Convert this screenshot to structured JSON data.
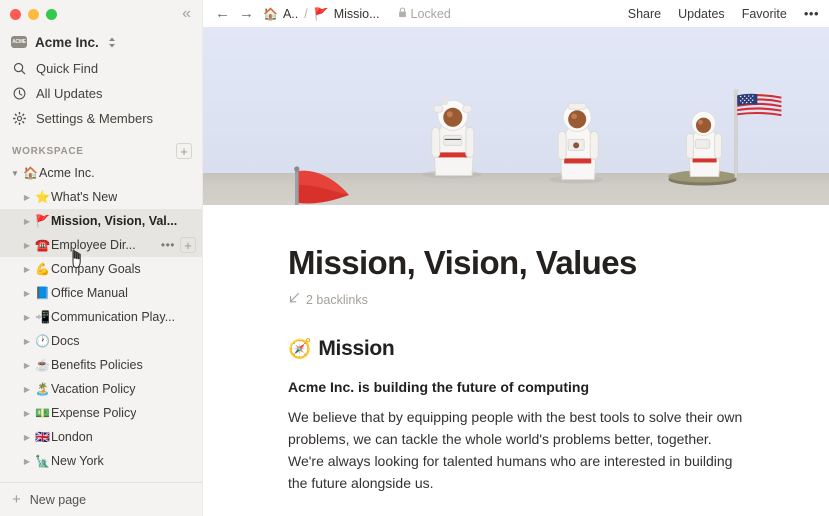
{
  "window": {
    "traffic_lights": [
      "close",
      "minimize",
      "zoom"
    ],
    "collapse_icon": "«"
  },
  "sidebar": {
    "workspace_switcher": {
      "name": "Acme Inc.",
      "logo_text": "ACME",
      "chevron": "⌃⌄"
    },
    "nav": [
      {
        "icon": "search-icon",
        "label": "Quick Find"
      },
      {
        "icon": "clock-icon",
        "label": "All Updates"
      },
      {
        "icon": "gear-icon",
        "label": "Settings & Members"
      }
    ],
    "section": {
      "title": "WORKSPACE",
      "add_label": "+"
    },
    "tree": [
      {
        "emoji": "🏠",
        "label": "Acme Inc.",
        "depth": 0,
        "expanded": true,
        "state": "normal"
      },
      {
        "emoji": "⭐",
        "label": "What's New",
        "depth": 1,
        "expanded": false,
        "state": "normal"
      },
      {
        "emoji": "🚩",
        "label": "Mission, Vision, Val...",
        "depth": 1,
        "expanded": false,
        "state": "selected"
      },
      {
        "emoji": "☎️",
        "label": "Employee Dir...",
        "depth": 1,
        "expanded": false,
        "state": "hovered"
      },
      {
        "emoji": "💪",
        "label": "Company Goals",
        "depth": 1,
        "expanded": false,
        "state": "normal"
      },
      {
        "emoji": "📘",
        "label": "Office Manual",
        "depth": 1,
        "expanded": false,
        "state": "normal"
      },
      {
        "emoji": "📲",
        "label": "Communication Play...",
        "depth": 1,
        "expanded": false,
        "state": "normal"
      },
      {
        "emoji": "🕐",
        "label": "Docs",
        "depth": 1,
        "expanded": false,
        "state": "normal"
      },
      {
        "emoji": "☕",
        "label": "Benefits Policies",
        "depth": 1,
        "expanded": false,
        "state": "normal"
      },
      {
        "emoji": "🏝️",
        "label": "Vacation Policy",
        "depth": 1,
        "expanded": false,
        "state": "normal"
      },
      {
        "emoji": "💵",
        "label": "Expense Policy",
        "depth": 1,
        "expanded": false,
        "state": "normal"
      },
      {
        "emoji": "🇬🇧",
        "label": "London",
        "depth": 1,
        "expanded": false,
        "state": "normal"
      },
      {
        "emoji": "🗽",
        "label": "New York",
        "depth": 1,
        "expanded": false,
        "state": "normal"
      }
    ],
    "row_actions": {
      "more": "•••",
      "add": "+"
    },
    "footer": {
      "plus": "+",
      "label": "New page"
    }
  },
  "topbar": {
    "back_icon": "←",
    "forward_icon": "→",
    "breadcrumb": [
      {
        "emoji": "🏠",
        "label": "A.."
      },
      {
        "emoji": "🚩",
        "label": "Missio..."
      }
    ],
    "separator": "/",
    "locked_label": "Locked",
    "actions": [
      "Share",
      "Updates",
      "Favorite"
    ],
    "more_icon": "•••"
  },
  "cover": {
    "sky_color": "#dde4f5",
    "desk_color": "#c9c6c2",
    "description": "astronaut figurines on desk"
  },
  "page": {
    "icon": "red-flag-icon",
    "title": "Mission, Vision, Values",
    "backlinks_icon": "↙",
    "backlinks_label": "2 backlinks",
    "heading_emoji": "🧭",
    "heading": "Mission",
    "lede": "Acme Inc. is building the future of computing",
    "paragraph": "We believe that by equipping people with the best tools to solve their own problems, we can tackle the whole world's problems better, together. We're always looking for talented humans who are interested in building the future alongside us."
  }
}
